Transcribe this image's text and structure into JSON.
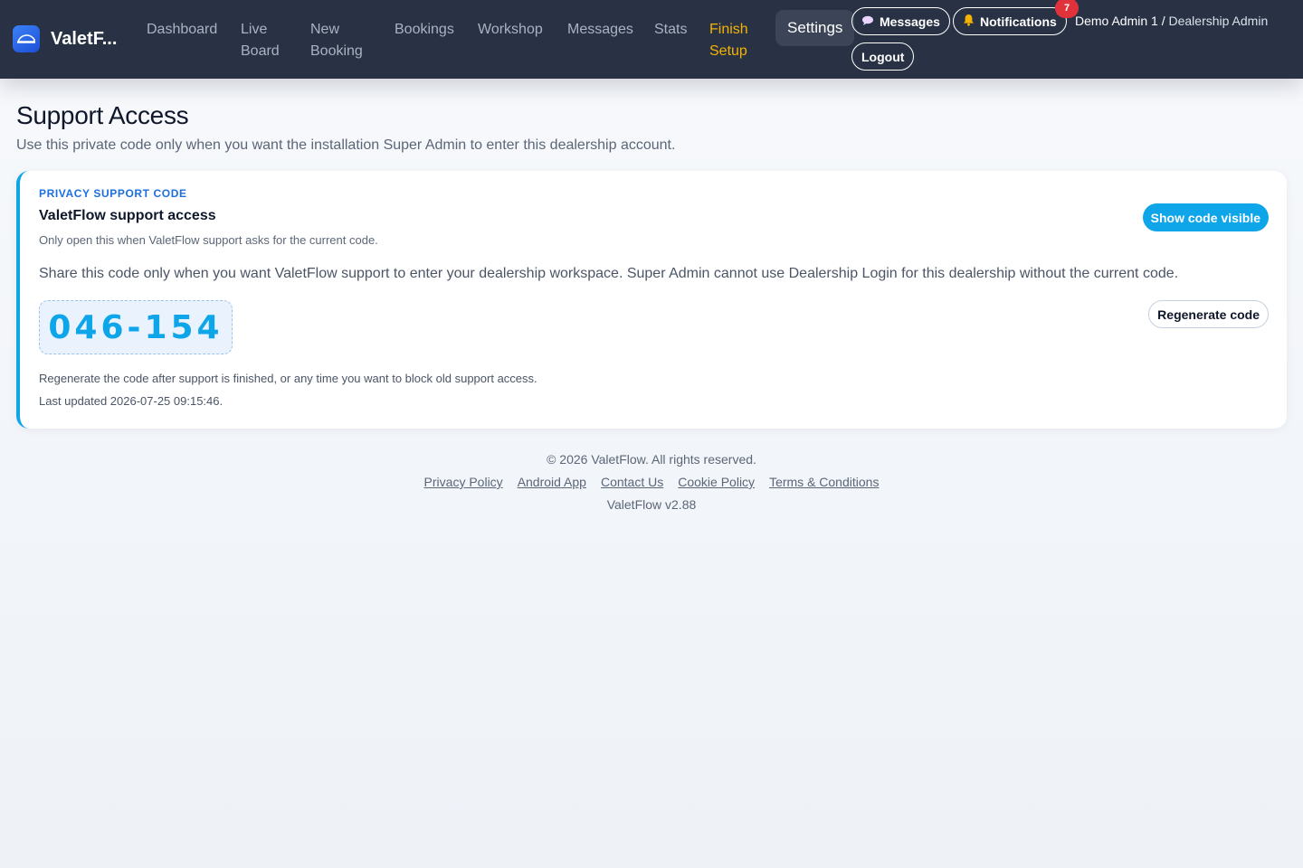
{
  "brand": {
    "name": "ValetF...",
    "logo_icon": "car-icon"
  },
  "nav": {
    "items": [
      {
        "label": "Dashboard"
      },
      {
        "label": "Live Board"
      },
      {
        "label": "New Booking"
      },
      {
        "label": "Bookings"
      },
      {
        "label": "Workshop"
      },
      {
        "label": "Messages"
      },
      {
        "label": "Stats"
      },
      {
        "label": "Finish Setup"
      },
      {
        "label": "Settings"
      }
    ],
    "active": "Settings",
    "highlight": "Finish Setup",
    "messages_button": {
      "label": "Messages",
      "icon": "speech-bubble-icon"
    },
    "notifications_button": {
      "label": "Notifications",
      "icon": "bell-icon",
      "count": "7"
    },
    "user": {
      "name": "Demo Admin 1",
      "separator": " / ",
      "role": "Dealership Admin"
    },
    "logout_label": "Logout"
  },
  "page": {
    "title": "Support Access",
    "subtitle": "Use this private code only when you want the installation Super Admin to enter this dealership account."
  },
  "card": {
    "eyebrow": "PRIVACY SUPPORT CODE",
    "title": "ValetFlow support access",
    "hint": "Only open this when ValetFlow support asks for the current code.",
    "show_button_label": "Show code visible",
    "description": "Share this code only when you want ValetFlow support to enter your dealership workspace. Super Admin cannot use Dealership Login for this dealership without the current code.",
    "code": "046-154",
    "regenerate_label": "Regenerate code",
    "note": "Regenerate the code after support is finished, or any time you want to block old support access.",
    "last_updated": "Last updated 2026-07-25 09:15:46."
  },
  "footer": {
    "copyright": "© 2026 ValetFlow. All rights reserved.",
    "links": [
      "Privacy Policy",
      "Android App",
      "Contact Us",
      "Cookie Policy",
      "Terms & Conditions"
    ],
    "version": "ValetFlow v2.88"
  },
  "colors": {
    "nav_bg": "#283244",
    "accent": "#0ea5e9",
    "highlight": "#f5b301",
    "badge": "#e0323a",
    "eyebrow": "#1d6fe0"
  }
}
